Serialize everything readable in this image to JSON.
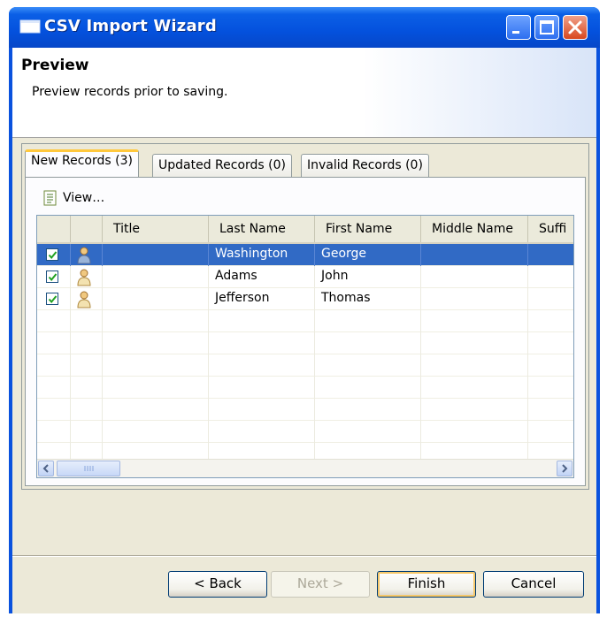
{
  "window": {
    "title": "CSV Import Wizard",
    "icon": "window-app-icon",
    "controls": [
      "minimize-icon",
      "maximize-icon",
      "close-icon"
    ]
  },
  "header": {
    "title": "Preview",
    "subtitle": "Preview records prior to saving."
  },
  "tabs": [
    {
      "label": "New Records (3)",
      "active": true
    },
    {
      "label": "Updated Records (0)",
      "active": false
    },
    {
      "label": "Invalid Records (0)",
      "active": false
    }
  ],
  "toolbar": {
    "view_label": "View…",
    "view_icon": "document-list-icon"
  },
  "table": {
    "columns": [
      "",
      "",
      "Title",
      "Last Name",
      "First Name",
      "Middle Name",
      "Suffi"
    ],
    "rows": [
      {
        "checked": true,
        "icon": "person-icon",
        "title": "",
        "last": "Washington",
        "first": "George",
        "middle": "",
        "suffix": "",
        "selected": true
      },
      {
        "checked": true,
        "icon": "person-icon",
        "title": "",
        "last": "Adams",
        "first": "John",
        "middle": "",
        "suffix": "",
        "selected": false
      },
      {
        "checked": true,
        "icon": "person-icon",
        "title": "",
        "last": "Jefferson",
        "first": "Thomas",
        "middle": "",
        "suffix": "",
        "selected": false
      }
    ],
    "empty_rows": 8
  },
  "buttons": {
    "back": "< Back",
    "next": "Next >",
    "finish": "Finish",
    "cancel": "Cancel"
  },
  "colors": {
    "titlebar": "#0451dd",
    "selection": "#316ac5",
    "tab_accent": "#ffc83c"
  }
}
